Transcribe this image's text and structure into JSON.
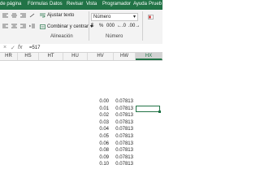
{
  "tabs": [
    "de página",
    "Fórmulas",
    "Datos",
    "Revisar",
    "Vista",
    "Programador",
    "Ayuda",
    "Prueb"
  ],
  "ribbon": {
    "wrap_text": "Ajustar texto",
    "merge_center": "Combinar y centrar",
    "merge_dropdown": "▾",
    "number_format": "Número",
    "number_format_arrow": "▾",
    "currency": "$",
    "percent": "%",
    "thousands": "000",
    "dec_increase": "←.0",
    "dec_decrease": ".00→",
    "group_alignment": "Alineación",
    "group_number": "Número"
  },
  "formula_bar": {
    "cancel": "×",
    "enter": "✓",
    "fx": "fx",
    "value": "=517"
  },
  "columns": [
    "HR",
    "HS",
    "HT",
    "HU",
    "HV",
    "HW",
    "HX"
  ],
  "selected_column": "HX",
  "rows": [
    {
      "hv": "0.00",
      "hw": "0.07813"
    },
    {
      "hv": "0.01",
      "hw": "0.07813"
    },
    {
      "hv": "0.02",
      "hw": "0.07813"
    },
    {
      "hv": "0.03",
      "hw": "0.07813"
    },
    {
      "hv": "0.04",
      "hw": "0.07813"
    },
    {
      "hv": "0.05",
      "hw": "0.07813"
    },
    {
      "hv": "0.06",
      "hw": "0.07813"
    },
    {
      "hv": "0.08",
      "hw": "0.07813"
    },
    {
      "hv": "0.09",
      "hw": "0.07813"
    },
    {
      "hv": "0.10",
      "hw": "0.07813"
    }
  ],
  "colors": {
    "accent": "#217346",
    "ribbon": "#f3f3f3"
  }
}
